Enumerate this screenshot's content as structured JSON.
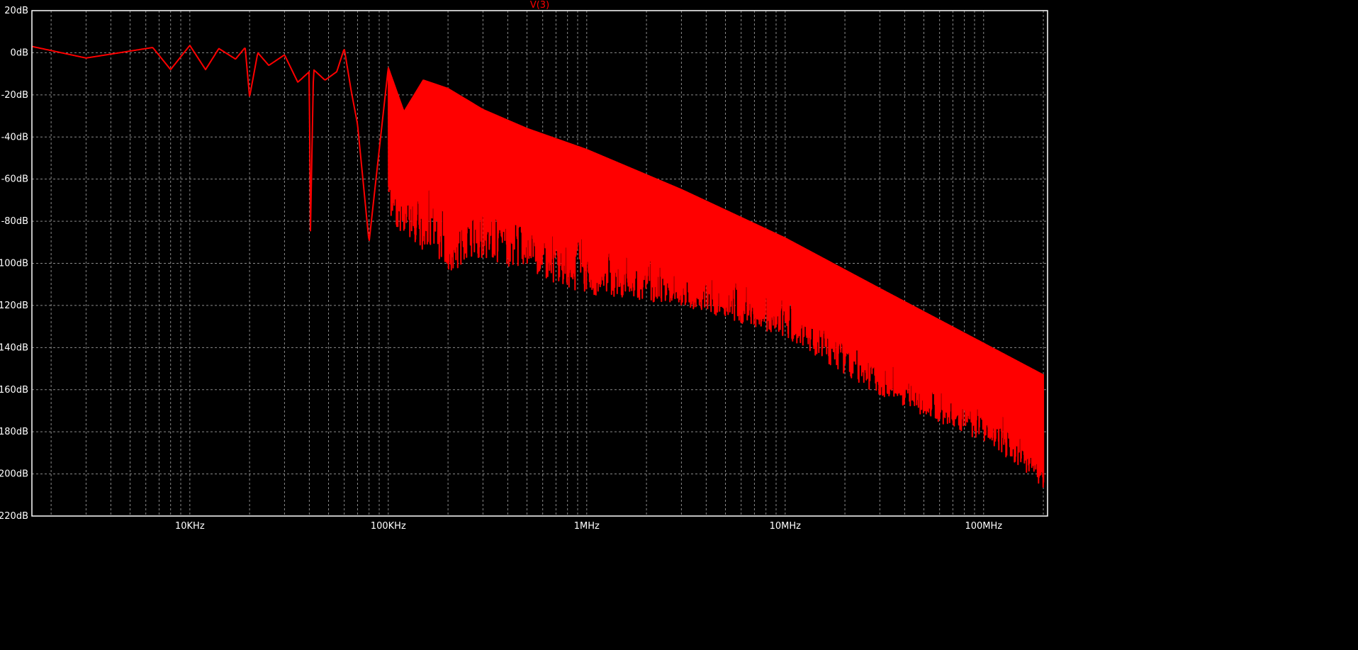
{
  "colors": {
    "background": "#000000",
    "axes": "#ffffff",
    "grid": "#8a8a8a",
    "trace": "#ff0000"
  },
  "chart_data": {
    "type": "line",
    "title": "V(3)",
    "xscale": "log",
    "xlim": [
      1600,
      210000000
    ],
    "ylim": [
      -220,
      20
    ],
    "y_ticks": [
      20,
      0,
      -20,
      -40,
      -60,
      -80,
      -100,
      -120,
      -140,
      -160,
      -180,
      -200,
      -220
    ],
    "y_tick_labels": [
      "20dB",
      "0dB",
      "-20dB",
      "-40dB",
      "-60dB",
      "-80dB",
      "-100dB",
      "-120dB",
      "-140dB",
      "-160dB",
      "-180dB",
      "-200dB",
      "-220dB"
    ],
    "x_ticks": [
      10000,
      100000,
      1000000,
      10000000,
      100000000
    ],
    "x_tick_labels": [
      "10KHz",
      "100KHz",
      "1MHz",
      "10MHz",
      "100MHz"
    ],
    "grid": true,
    "series": [
      {
        "name": "V(3)",
        "envelope_upper": [
          [
            1600,
            3
          ],
          [
            3000,
            -2.5
          ],
          [
            6500,
            2.5
          ],
          [
            8000,
            -8
          ],
          [
            10000,
            3.5
          ],
          [
            12000,
            -8
          ],
          [
            14000,
            2
          ],
          [
            17000,
            -3
          ],
          [
            19000,
            2.5
          ],
          [
            20000,
            -21
          ],
          [
            22000,
            0
          ],
          [
            25000,
            -6
          ],
          [
            30000,
            -1
          ],
          [
            35000,
            -14
          ],
          [
            40000,
            -9
          ],
          [
            40500,
            -86
          ],
          [
            42000,
            -8
          ],
          [
            48000,
            -13
          ],
          [
            55000,
            -9
          ],
          [
            60000,
            2
          ],
          [
            65000,
            -18
          ],
          [
            70000,
            -34
          ],
          [
            80000,
            -90
          ],
          [
            100000,
            -7
          ],
          [
            120000,
            -28
          ],
          [
            150000,
            -13
          ],
          [
            200000,
            -17
          ],
          [
            300000,
            -27
          ],
          [
            500000,
            -36
          ],
          [
            1000000,
            -46
          ],
          [
            3000000,
            -65
          ],
          [
            10000000,
            -88
          ],
          [
            30000000,
            -112
          ],
          [
            100000000,
            -138
          ],
          [
            200000000,
            -153
          ]
        ],
        "envelope_lower": [
          [
            100000,
            -80
          ],
          [
            200000,
            -104
          ],
          [
            300000,
            -98
          ],
          [
            500000,
            -104
          ],
          [
            1000000,
            -115
          ],
          [
            3000000,
            -120
          ],
          [
            10000000,
            -135
          ],
          [
            30000000,
            -163
          ],
          [
            100000000,
            -185
          ],
          [
            150000000,
            -196
          ],
          [
            200000000,
            -207
          ]
        ]
      }
    ]
  }
}
